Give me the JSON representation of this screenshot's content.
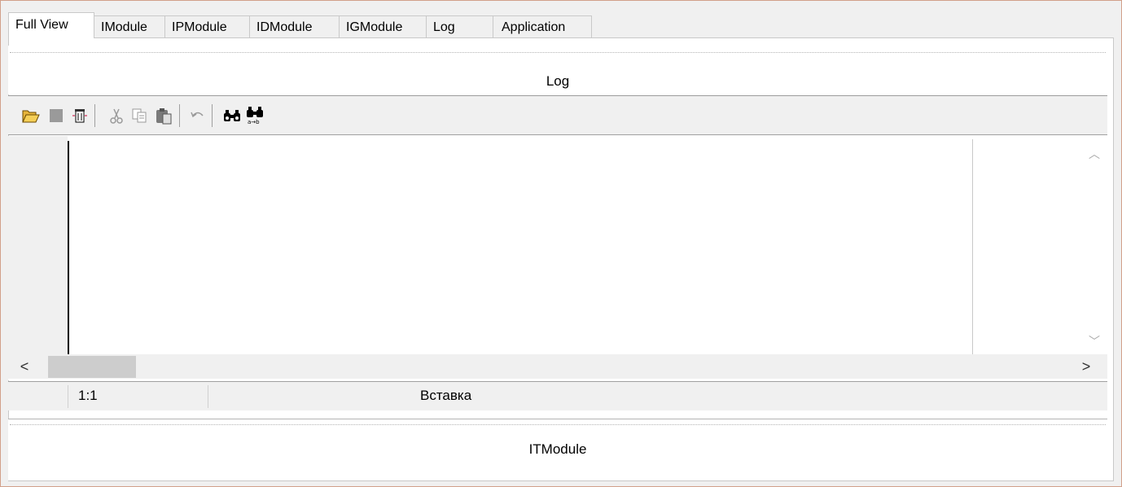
{
  "tabs": [
    {
      "label": "Full View",
      "active": true
    },
    {
      "label": "IModule",
      "active": false
    },
    {
      "label": "IPModule",
      "active": false
    },
    {
      "label": "IDModule",
      "active": false
    },
    {
      "label": "IGModule",
      "active": false
    },
    {
      "label": "Log",
      "active": false
    },
    {
      "label": "Application",
      "active": false
    }
  ],
  "log_pane": {
    "title": "Log"
  },
  "toolbar": {
    "buttons": [
      "open-folder-icon",
      "stop-icon",
      "clear-icon",
      "cut-icon",
      "copy-icon",
      "paste-icon",
      "undo-icon",
      "find-icon",
      "find-replace-icon"
    ]
  },
  "status_bar": {
    "position": "1:1",
    "mode": "Вставка"
  },
  "bottom_pane": {
    "title": "ITModule"
  },
  "colors": {
    "frame_border": "#d2a08a",
    "background": "#f0f0f0",
    "panel": "#ffffff"
  }
}
